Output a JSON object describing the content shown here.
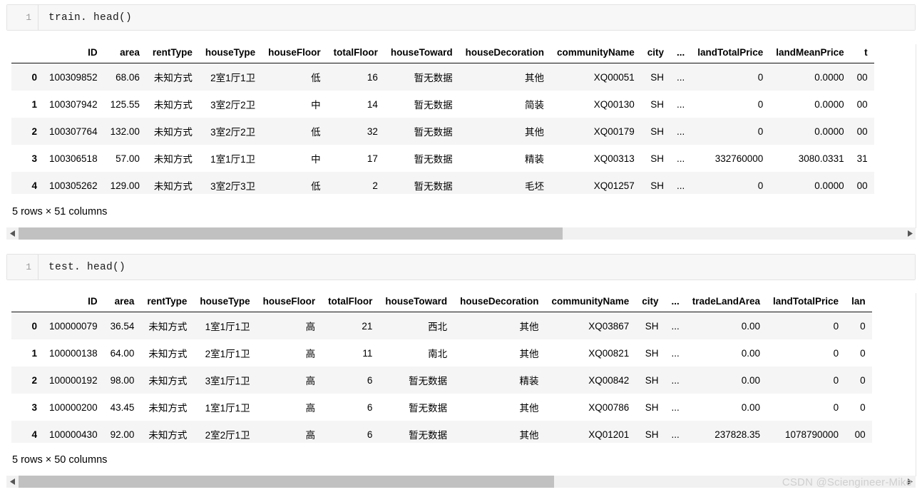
{
  "notebook": {
    "cells": [
      {
        "prompt": "1",
        "source": "train. head()",
        "shape_note": "5 rows × 51 columns"
      },
      {
        "prompt": "1",
        "source": "test. head()",
        "shape_note": "5 rows × 50 columns"
      }
    ]
  },
  "train_table": {
    "columns": [
      "",
      "ID",
      "area",
      "rentType",
      "houseType",
      "houseFloor",
      "totalFloor",
      "houseToward",
      "houseDecoration",
      "communityName",
      "city",
      "...",
      "landTotalPrice",
      "landMeanPrice",
      "t"
    ],
    "rows": [
      {
        "index": "0",
        "ID": "100309852",
        "area": "68.06",
        "rentType": "未知方式",
        "houseType": "2室1厅1卫",
        "houseFloor": "低",
        "totalFloor": "16",
        "houseToward": "暂无数据",
        "houseDecoration": "其他",
        "communityName": "XQ00051",
        "city": "SH",
        "ellipsis": "...",
        "landTotalPrice": "0",
        "landMeanPrice": "0.0000",
        "trailing": "00"
      },
      {
        "index": "1",
        "ID": "100307942",
        "area": "125.55",
        "rentType": "未知方式",
        "houseType": "3室2厅2卫",
        "houseFloor": "中",
        "totalFloor": "14",
        "houseToward": "暂无数据",
        "houseDecoration": "简装",
        "communityName": "XQ00130",
        "city": "SH",
        "ellipsis": "...",
        "landTotalPrice": "0",
        "landMeanPrice": "0.0000",
        "trailing": "00"
      },
      {
        "index": "2",
        "ID": "100307764",
        "area": "132.00",
        "rentType": "未知方式",
        "houseType": "3室2厅2卫",
        "houseFloor": "低",
        "totalFloor": "32",
        "houseToward": "暂无数据",
        "houseDecoration": "其他",
        "communityName": "XQ00179",
        "city": "SH",
        "ellipsis": "...",
        "landTotalPrice": "0",
        "landMeanPrice": "0.0000",
        "trailing": "00"
      },
      {
        "index": "3",
        "ID": "100306518",
        "area": "57.00",
        "rentType": "未知方式",
        "houseType": "1室1厅1卫",
        "houseFloor": "中",
        "totalFloor": "17",
        "houseToward": "暂无数据",
        "houseDecoration": "精装",
        "communityName": "XQ00313",
        "city": "SH",
        "ellipsis": "...",
        "landTotalPrice": "332760000",
        "landMeanPrice": "3080.0331",
        "trailing": "31"
      },
      {
        "index": "4",
        "ID": "100305262",
        "area": "129.00",
        "rentType": "未知方式",
        "houseType": "3室2厅3卫",
        "houseFloor": "低",
        "totalFloor": "2",
        "houseToward": "暂无数据",
        "houseDecoration": "毛坯",
        "communityName": "XQ01257",
        "city": "SH",
        "ellipsis": "...",
        "landTotalPrice": "0",
        "landMeanPrice": "0.0000",
        "trailing": "00"
      }
    ],
    "scrollbar": {
      "thumb_left_pct": 0,
      "thumb_width_pct": 61.5
    }
  },
  "test_table": {
    "columns": [
      "",
      "ID",
      "area",
      "rentType",
      "houseType",
      "houseFloor",
      "totalFloor",
      "houseToward",
      "houseDecoration",
      "communityName",
      "city",
      "...",
      "tradeLandArea",
      "landTotalPrice",
      "lan"
    ],
    "rows": [
      {
        "index": "0",
        "ID": "100000079",
        "area": "36.54",
        "rentType": "未知方式",
        "houseType": "1室1厅1卫",
        "houseFloor": "高",
        "totalFloor": "21",
        "houseToward": "西北",
        "houseDecoration": "其他",
        "communityName": "XQ03867",
        "city": "SH",
        "ellipsis": "...",
        "tradeLandArea": "0.00",
        "landTotalPrice": "0",
        "trailing": "0"
      },
      {
        "index": "1",
        "ID": "100000138",
        "area": "64.00",
        "rentType": "未知方式",
        "houseType": "2室1厅1卫",
        "houseFloor": "高",
        "totalFloor": "11",
        "houseToward": "南北",
        "houseDecoration": "其他",
        "communityName": "XQ00821",
        "city": "SH",
        "ellipsis": "...",
        "tradeLandArea": "0.00",
        "landTotalPrice": "0",
        "trailing": "0"
      },
      {
        "index": "2",
        "ID": "100000192",
        "area": "98.00",
        "rentType": "未知方式",
        "houseType": "3室1厅1卫",
        "houseFloor": "高",
        "totalFloor": "6",
        "houseToward": "暂无数据",
        "houseDecoration": "精装",
        "communityName": "XQ00842",
        "city": "SH",
        "ellipsis": "...",
        "tradeLandArea": "0.00",
        "landTotalPrice": "0",
        "trailing": "0"
      },
      {
        "index": "3",
        "ID": "100000200",
        "area": "43.45",
        "rentType": "未知方式",
        "houseType": "1室1厅1卫",
        "houseFloor": "高",
        "totalFloor": "6",
        "houseToward": "暂无数据",
        "houseDecoration": "其他",
        "communityName": "XQ00786",
        "city": "SH",
        "ellipsis": "...",
        "tradeLandArea": "0.00",
        "landTotalPrice": "0",
        "trailing": "0"
      },
      {
        "index": "4",
        "ID": "100000430",
        "area": "92.00",
        "rentType": "未知方式",
        "houseType": "2室2厅1卫",
        "houseFloor": "高",
        "totalFloor": "6",
        "houseToward": "暂无数据",
        "houseDecoration": "其他",
        "communityName": "XQ01201",
        "city": "SH",
        "ellipsis": "...",
        "tradeLandArea": "237828.35",
        "landTotalPrice": "1078790000",
        "trailing": "00"
      }
    ],
    "scrollbar": {
      "thumb_left_pct": 0,
      "thumb_width_pct": 60.5
    }
  },
  "watermark": {
    "text": "CSDN @Sciengineer-Mike"
  }
}
